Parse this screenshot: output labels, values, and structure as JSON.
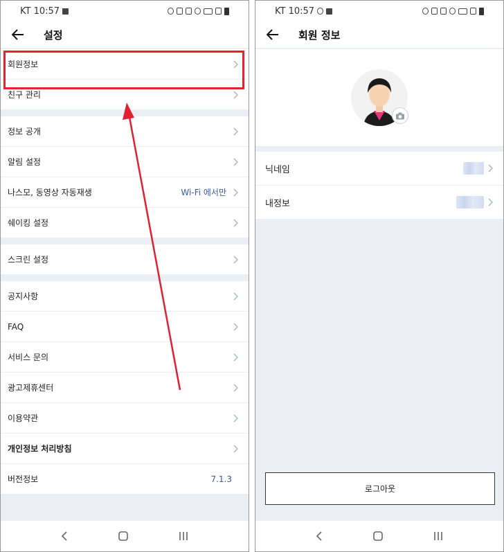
{
  "left": {
    "status": {
      "carrier_time": "KT 10:57"
    },
    "title": "설정",
    "groups": [
      [
        {
          "label": "회원정보"
        },
        {
          "label": "친구 관리"
        }
      ],
      [
        {
          "label": "정보 공개"
        },
        {
          "label": "알림 설정"
        },
        {
          "label": "나스모, 동영상 자동재생",
          "value": "Wi-Fi 에서만"
        },
        {
          "label": "쉐이킹 설정"
        }
      ],
      [
        {
          "label": "스크린 설정"
        }
      ],
      [
        {
          "label": "공지사항"
        },
        {
          "label": "FAQ"
        },
        {
          "label": "서비스 문의"
        },
        {
          "label": "광고제휴센터"
        },
        {
          "label": "이용약관"
        },
        {
          "label": "개인정보 처리방침"
        },
        {
          "label": "버전정보",
          "value": "7.1.3"
        }
      ]
    ]
  },
  "right": {
    "status": {
      "carrier_time": "KT 10:57"
    },
    "title": "회원 정보",
    "rows": [
      {
        "label": "닉네임"
      },
      {
        "label": "내정보"
      }
    ],
    "logout_label": "로그아웃"
  },
  "colors": {
    "highlight": "#e8212b",
    "accent_value": "#3a5a9b"
  },
  "icons": [
    "back-arrow-icon",
    "chevron-right-icon",
    "camera-icon",
    "nav-back-icon",
    "nav-home-icon",
    "nav-recents-icon"
  ]
}
